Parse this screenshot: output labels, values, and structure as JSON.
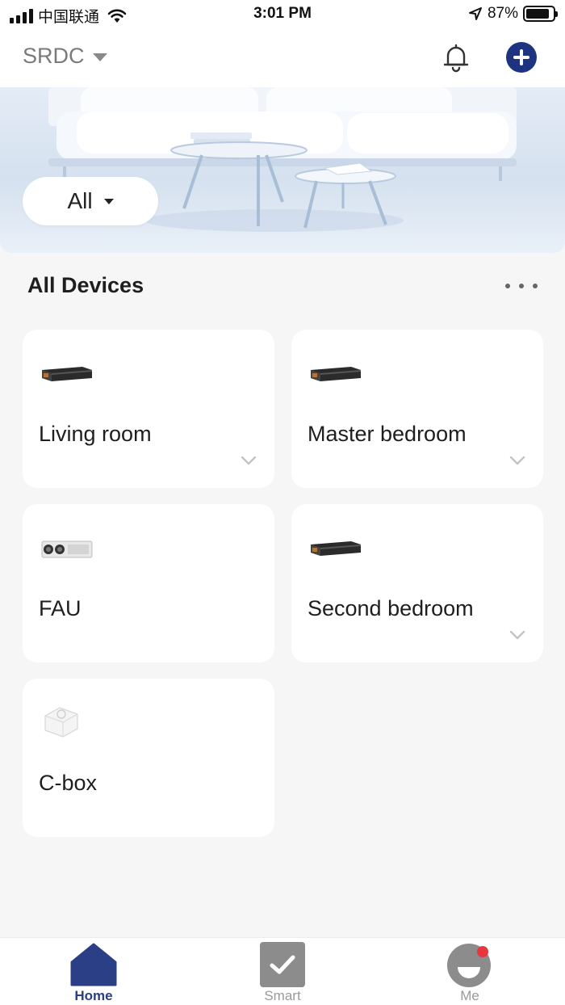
{
  "status_bar": {
    "carrier": "中国联通",
    "time": "3:01 PM",
    "battery_percent": "87%",
    "battery_level": 0.87,
    "icons": [
      "signal-icon",
      "wifi-icon",
      "location-arrow-icon",
      "battery-icon"
    ]
  },
  "header": {
    "home_name": "SRDC",
    "icons": [
      "caret-down-icon",
      "bell-icon",
      "add-icon"
    ],
    "accent_color": "#1e3480"
  },
  "banner": {
    "filter_label": "All"
  },
  "section": {
    "title": "All Devices",
    "more_icon": "more-dots-icon"
  },
  "devices": [
    {
      "name": "Living room",
      "icon": "ducted-ac-unit-icon",
      "expandable": true
    },
    {
      "name": "Master bedroom",
      "icon": "ducted-ac-unit-icon",
      "expandable": true
    },
    {
      "name": "FAU",
      "icon": "fresh-air-unit-icon",
      "expandable": false
    },
    {
      "name": "Second bedroom",
      "icon": "ducted-ac-unit-icon",
      "expandable": true
    },
    {
      "name": "C-box",
      "icon": "c-box-hub-icon",
      "expandable": false
    }
  ],
  "bottom_nav": {
    "items": [
      {
        "label": "Home",
        "icon": "home-icon",
        "active": true
      },
      {
        "label": "Smart",
        "icon": "smart-check-icon",
        "active": false
      },
      {
        "label": "Me",
        "icon": "me-face-icon",
        "active": false,
        "has_notification": true
      }
    ],
    "active_color": "#2b3f86",
    "notification_color": "#e8373c"
  }
}
